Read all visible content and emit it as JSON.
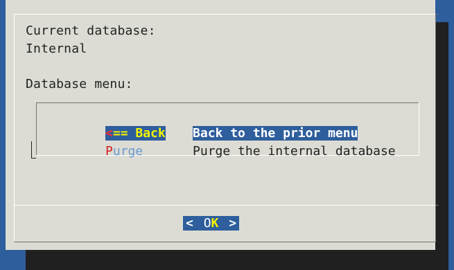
{
  "dialog": {
    "current_db_label": "Current database:",
    "current_db_value": "Internal",
    "menu_label": "Database menu:"
  },
  "menu": {
    "items": [
      {
        "tag_hot": "<",
        "tag_rest": "== Back",
        "description": "Back to the prior menu",
        "selected": true
      },
      {
        "tag_hot": "P",
        "tag_rest": "urge",
        "description": "Purge the internal database",
        "selected": false
      }
    ]
  },
  "buttons": {
    "ok": {
      "left_bracket": "<",
      "pre": "O",
      "hot": "K",
      "right_bracket": ">"
    }
  },
  "colors": {
    "background": "#2e5e9c",
    "dialog": "#dcdcd5",
    "selected_bg": "#2e5e9c",
    "selected_tag": "#f4f400",
    "hotkey": "#d21f1f",
    "tag_normal": "#6a9ad0"
  }
}
